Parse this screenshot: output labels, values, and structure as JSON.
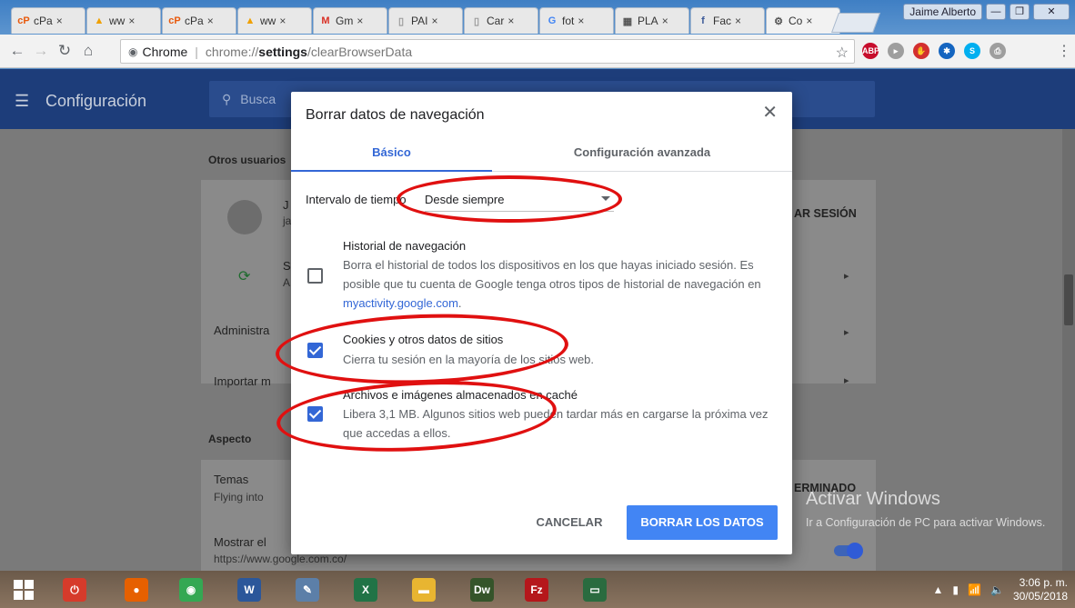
{
  "browser": {
    "tabs": [
      {
        "label": "cPa",
        "favicon": "cpanel-icon",
        "color": "#e8590c"
      },
      {
        "label": "ww",
        "favicon": "pma-icon",
        "color": "#f0a000"
      },
      {
        "label": "cPa",
        "favicon": "cpanel-icon",
        "color": "#e8590c"
      },
      {
        "label": "ww",
        "favicon": "pma-icon",
        "color": "#f0a000"
      },
      {
        "label": "Gm",
        "favicon": "gmail-icon",
        "color": "#d93025"
      },
      {
        "label": "PAI",
        "favicon": "doc-icon",
        "color": "#999999"
      },
      {
        "label": "Car",
        "favicon": "doc-icon",
        "color": "#999999"
      },
      {
        "label": "fot",
        "favicon": "google-icon",
        "color": "#4285f4"
      },
      {
        "label": "PLA",
        "favicon": "building-icon",
        "color": "#555555"
      },
      {
        "label": "Fac",
        "favicon": "facebook-icon",
        "color": "#3b5998"
      },
      {
        "label": "Co",
        "favicon": "gear-icon",
        "color": "#555555"
      }
    ],
    "tab_close_glyph": "×",
    "profile_name": "Jaime Alberto",
    "omnibox": {
      "site_label": "Chrome",
      "url_scheme": "chrome://",
      "url_host": "settings",
      "url_path": "/clearBrowserData"
    },
    "extensions": [
      {
        "name": "adblock-icon",
        "label": "ABP",
        "color": "#c70d2c"
      },
      {
        "name": "arrow-ext-icon",
        "label": "▸",
        "color": "#9e9e9e"
      },
      {
        "name": "stop-ext-icon",
        "label": "✋",
        "color": "#d32f2f"
      },
      {
        "name": "puzzle-ext-icon",
        "label": "✱",
        "color": "#1565c0"
      },
      {
        "name": "skype-ext-icon",
        "label": "S",
        "color": "#00aff0"
      },
      {
        "name": "pdf-ext-icon",
        "label": "⎙",
        "color": "#9e9e9e"
      }
    ]
  },
  "settings": {
    "title": "Configuración",
    "search_placeholder": "Busca",
    "sections": {
      "people_label": "Otros usuarios",
      "appearance_label": "Aspecto"
    },
    "rows": {
      "user_initial": "J",
      "user_sub": "ja",
      "signout": "AR SESIÓN",
      "sync_initial": "S",
      "sync_sub": "A",
      "admin": "Administra",
      "import": "Importar m",
      "themes": "Temas",
      "themes_sub": "Flying into",
      "show": "Mostrar el",
      "show_sub": "https://www.google.com.co/",
      "determined": "ERMINADO"
    },
    "windows_activation": {
      "title": "Activar Windows",
      "body": "Ir a Configuración de PC para activar Windows."
    }
  },
  "dialog": {
    "title": "Borrar datos de navegación",
    "close_glyph": "✕",
    "tabs": {
      "basic": "Básico",
      "advanced": "Configuración avanzada"
    },
    "time_range": {
      "label": "Intervalo de tiempo",
      "value": "Desde siempre"
    },
    "options": [
      {
        "title": "Historial de navegación",
        "desc_pre": "Borra el historial de todos los dispositivos en los que hayas iniciado sesión. Es posible que tu cuenta de Google tenga otros tipos de historial de navegación en ",
        "link": "myactivity.google.com",
        "desc_post": ".",
        "checked": false
      },
      {
        "title": "Cookies y otros datos de sitios",
        "desc": "Cierra tu sesión en la mayoría de los sitios web.",
        "checked": true
      },
      {
        "title": "Archivos e imágenes almacenados en caché",
        "desc": "Libera 3,1 MB. Algunos sitios web pueden tardar más en cargarse la próxima vez que accedas a ellos.",
        "checked": true
      }
    ],
    "cancel_label": "CANCELAR",
    "confirm_label": "BORRAR LOS DATOS"
  },
  "taskbar": {
    "apps": [
      {
        "name": "shutdown-app-icon",
        "label": "⏻",
        "color": "#d63b2b"
      },
      {
        "name": "firefox-app-icon",
        "label": "●",
        "color": "#e66000"
      },
      {
        "name": "chrome-app-icon",
        "label": "◉",
        "color": "#34a853"
      },
      {
        "name": "word-app-icon",
        "label": "W",
        "color": "#2b579a"
      },
      {
        "name": "notepad-app-icon",
        "label": "✎",
        "color": "#5c7fa8"
      },
      {
        "name": "excel-app-icon",
        "label": "X",
        "color": "#217346"
      },
      {
        "name": "explorer-app-icon",
        "label": "▬",
        "color": "#e8b531"
      },
      {
        "name": "dreamweaver-app-icon",
        "label": "Dw",
        "color": "#35542a"
      },
      {
        "name": "filezilla-app-icon",
        "label": "Fz",
        "color": "#b5171b"
      },
      {
        "name": "remote-app-icon",
        "label": "▭",
        "color": "#2a6b3f"
      }
    ],
    "clock_time": "3:06 p. m.",
    "clock_date": "30/05/2018"
  },
  "colors": {
    "accent": "#3367d6",
    "confirm_button": "#4285f4",
    "annotation_red": "#e01010"
  }
}
